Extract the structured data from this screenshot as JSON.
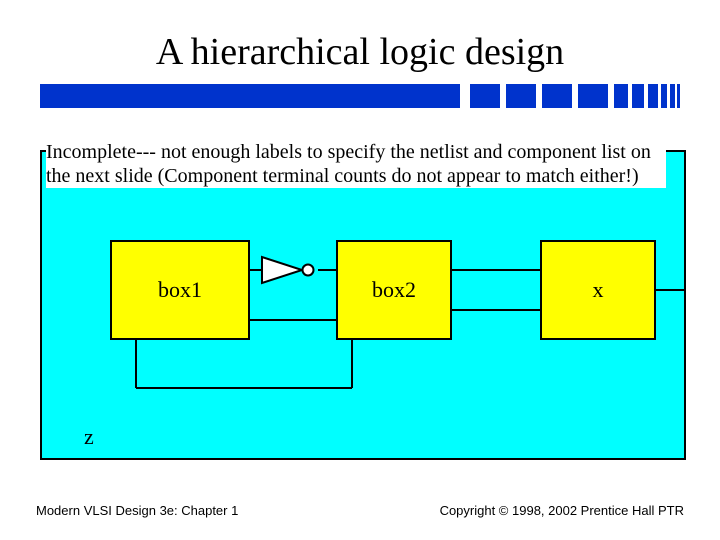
{
  "title": "A hierarchical logic design",
  "caption": "Incomplete--- not enough labels to specify the netlist and component list on the next slide (Component terminal counts do not appear to match either!)",
  "boxes": {
    "box1": "box1",
    "box2": "box2",
    "box3": "x"
  },
  "z_label": "z",
  "footer_left": "Modern VLSI Design 3e: Chapter 1",
  "footer_right": "Copyright © 1998, 2002 Prentice Hall PTR",
  "colors": {
    "divider": "#0033cc",
    "bg_cyan": "#00ffff",
    "box_fill": "#ffff00"
  }
}
